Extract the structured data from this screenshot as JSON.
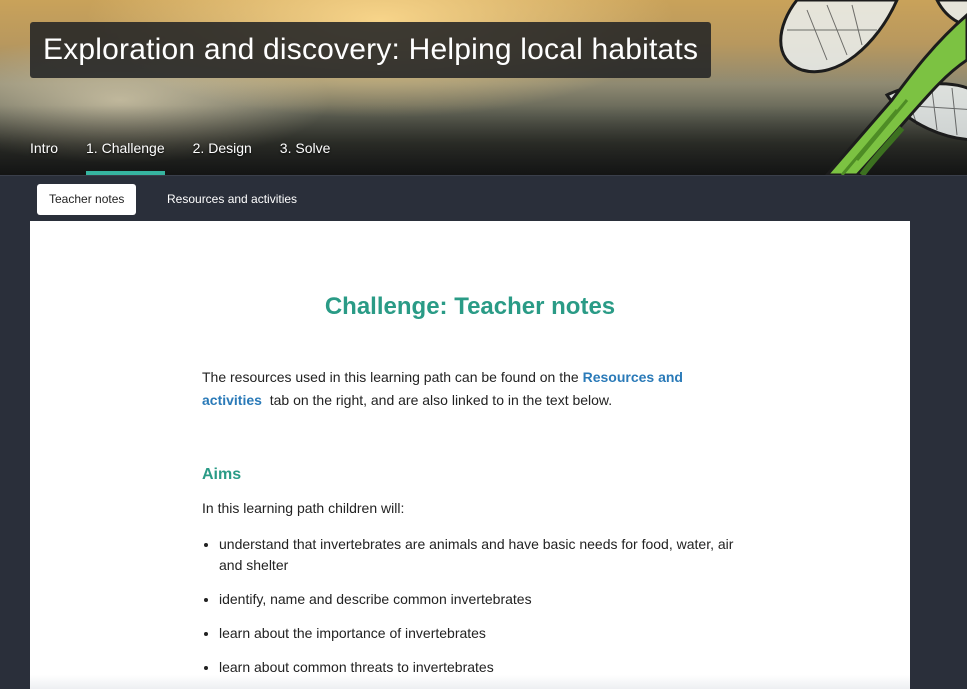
{
  "header": {
    "title": "Exploration and discovery: Helping local habitats",
    "illustration_icon": "dragonfly-icon"
  },
  "main_tabs": [
    {
      "label": "Intro",
      "active": false
    },
    {
      "label": "1. Challenge",
      "active": true
    },
    {
      "label": "2. Design",
      "active": false
    },
    {
      "label": "3. Solve",
      "active": false
    }
  ],
  "sub_tabs": [
    {
      "label": "Teacher notes",
      "active": true
    },
    {
      "label": "Resources and activities",
      "active": false
    }
  ],
  "content": {
    "heading": "Challenge: Teacher notes",
    "intro": {
      "before": "The resources used in this learning path can be found on the ",
      "link": "Resources and activities",
      "after": " tab on the right, and are also linked to in the text below."
    },
    "aims_heading": "Aims",
    "aims_intro": "In this learning path children will:",
    "aims": [
      "understand that invertebrates are animals and have basic needs for food, water, air and shelter",
      "identify, name and describe common invertebrates",
      "learn about the importance of invertebrates",
      "learn about common threats to invertebrates"
    ]
  },
  "colors": {
    "accent": "#36b4a0",
    "heading": "#2a9b86",
    "link": "#2a7ab8",
    "nav_background": "#2a2f3a",
    "dragonfly_body": "#7cc242"
  }
}
